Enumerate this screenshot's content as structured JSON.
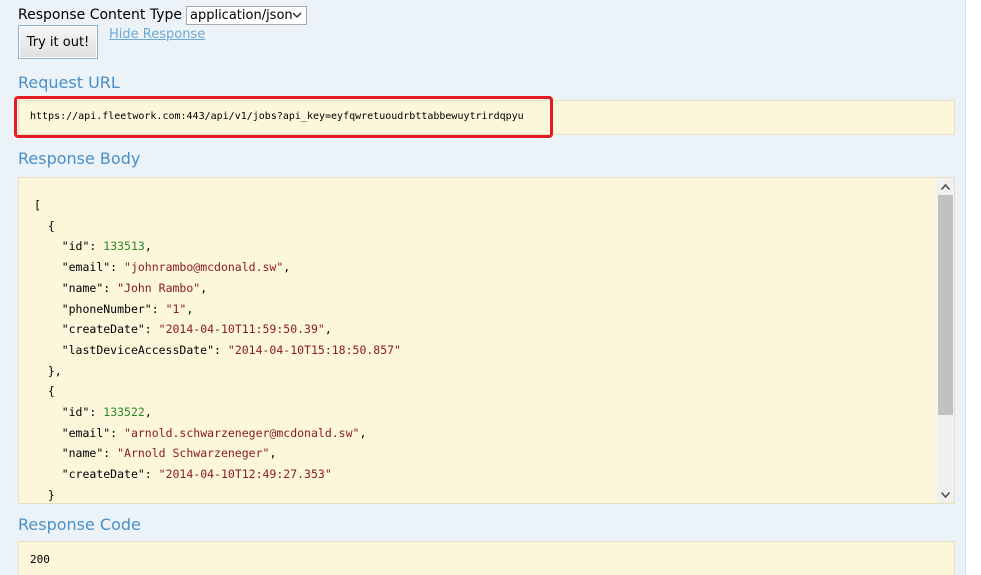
{
  "content_type": {
    "label": "Response Content Type",
    "selected": "application/json"
  },
  "actions": {
    "try_label": "Try it out!",
    "hide_label": "Hide Response"
  },
  "request_url": {
    "title": "Request URL",
    "value": "https://api.fleetwork.com:443/api/v1/jobs?api_key=eyfqwretuoudrbttabbewuytrirdqpyu"
  },
  "response_body": {
    "title": "Response Body",
    "lines": [
      {
        "indent": 0,
        "parts": [
          {
            "t": "p",
            "v": "["
          }
        ]
      },
      {
        "indent": 1,
        "parts": [
          {
            "t": "p",
            "v": "{"
          }
        ]
      },
      {
        "indent": 2,
        "parts": [
          {
            "t": "k",
            "v": "\"id\""
          },
          {
            "t": "p",
            "v": ": "
          },
          {
            "t": "n",
            "v": "133513"
          },
          {
            "t": "p",
            "v": ","
          }
        ]
      },
      {
        "indent": 2,
        "parts": [
          {
            "t": "k",
            "v": "\"email\""
          },
          {
            "t": "p",
            "v": ": "
          },
          {
            "t": "s",
            "v": "\"johnrambo@mcdonald.sw\""
          },
          {
            "t": "p",
            "v": ","
          }
        ]
      },
      {
        "indent": 2,
        "parts": [
          {
            "t": "k",
            "v": "\"name\""
          },
          {
            "t": "p",
            "v": ": "
          },
          {
            "t": "s",
            "v": "\"John Rambo\""
          },
          {
            "t": "p",
            "v": ","
          }
        ]
      },
      {
        "indent": 2,
        "parts": [
          {
            "t": "k",
            "v": "\"phoneNumber\""
          },
          {
            "t": "p",
            "v": ": "
          },
          {
            "t": "s",
            "v": "\"1\""
          },
          {
            "t": "p",
            "v": ","
          }
        ]
      },
      {
        "indent": 2,
        "parts": [
          {
            "t": "k",
            "v": "\"createDate\""
          },
          {
            "t": "p",
            "v": ": "
          },
          {
            "t": "s",
            "v": "\"2014-04-10T11:59:50.39\""
          },
          {
            "t": "p",
            "v": ","
          }
        ]
      },
      {
        "indent": 2,
        "parts": [
          {
            "t": "k",
            "v": "\"lastDeviceAccessDate\""
          },
          {
            "t": "p",
            "v": ": "
          },
          {
            "t": "s",
            "v": "\"2014-04-10T15:18:50.857\""
          }
        ]
      },
      {
        "indent": 1,
        "parts": [
          {
            "t": "p",
            "v": "},"
          }
        ]
      },
      {
        "indent": 1,
        "parts": [
          {
            "t": "p",
            "v": "{"
          }
        ]
      },
      {
        "indent": 2,
        "parts": [
          {
            "t": "k",
            "v": "\"id\""
          },
          {
            "t": "p",
            "v": ": "
          },
          {
            "t": "n",
            "v": "133522"
          },
          {
            "t": "p",
            "v": ","
          }
        ]
      },
      {
        "indent": 2,
        "parts": [
          {
            "t": "k",
            "v": "\"email\""
          },
          {
            "t": "p",
            "v": ": "
          },
          {
            "t": "s",
            "v": "\"arnold.schwarzeneger@mcdonald.sw\""
          },
          {
            "t": "p",
            "v": ","
          }
        ]
      },
      {
        "indent": 2,
        "parts": [
          {
            "t": "k",
            "v": "\"name\""
          },
          {
            "t": "p",
            "v": ": "
          },
          {
            "t": "s",
            "v": "\"Arnold Schwarzeneger\""
          },
          {
            "t": "p",
            "v": ","
          }
        ]
      },
      {
        "indent": 2,
        "parts": [
          {
            "t": "k",
            "v": "\"createDate\""
          },
          {
            "t": "p",
            "v": ": "
          },
          {
            "t": "s",
            "v": "\"2014-04-10T12:49:27.353\""
          }
        ]
      },
      {
        "indent": 1,
        "parts": [
          {
            "t": "p",
            "v": "}"
          }
        ]
      }
    ]
  },
  "response_code": {
    "title": "Response Code",
    "value": "200"
  },
  "icons": {
    "select_arrow": "chevron-down-icon",
    "scroll_up": "triangle-up-icon",
    "scroll_down": "triangle-down-icon"
  },
  "colors": {
    "highlight": "#e31b23",
    "title": "#4a8fc8",
    "number": "#2a8a2a",
    "string": "#8b1a1a"
  }
}
